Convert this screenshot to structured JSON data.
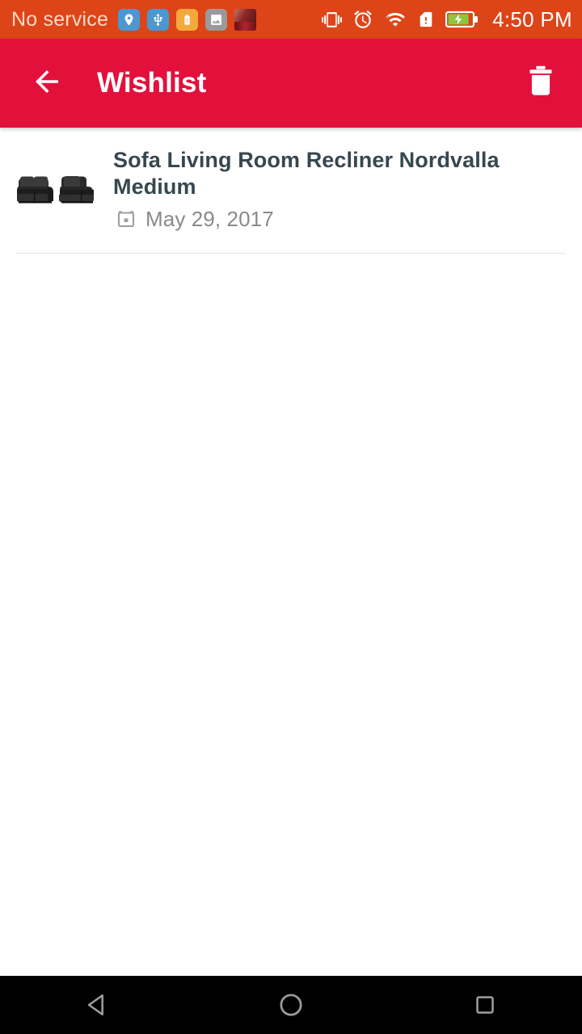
{
  "status_bar": {
    "carrier": "No service",
    "time": "4:50 PM",
    "background": "#dd4418",
    "notification_icons": [
      {
        "name": "location-pin-icon",
        "color": "#4a97d2"
      },
      {
        "name": "usb-icon",
        "color": "#4a97d2"
      },
      {
        "name": "battery-saver-icon",
        "color": "#f5a83c"
      },
      {
        "name": "image-icon",
        "color": "#9a9a9a"
      },
      {
        "name": "photo-thumbnail-icon",
        "color": "#7a1620"
      }
    ],
    "system_icons": [
      {
        "name": "vibrate-icon"
      },
      {
        "name": "alarm-clock-icon"
      },
      {
        "name": "wifi-icon"
      },
      {
        "name": "sim-card-alert-icon"
      },
      {
        "name": "battery-charging-icon",
        "fill_color": "#8dc63f"
      }
    ]
  },
  "app_bar": {
    "title": "Wishlist",
    "background": "#e3103c",
    "back_icon": "arrow-back-icon",
    "delete_icon": "delete-trash-icon"
  },
  "wishlist": {
    "items": [
      {
        "title": "Sofa Living Room Recliner Nordvalla Medium",
        "date": "May 29, 2017",
        "date_icon": "calendar-icon",
        "thumbnail": "black-leather-sofa-recliner-image"
      }
    ]
  },
  "nav_bar": {
    "background": "#000000",
    "buttons": [
      {
        "name": "nav-back-button",
        "icon": "triangle-back-icon"
      },
      {
        "name": "nav-home-button",
        "icon": "circle-home-icon"
      },
      {
        "name": "nav-recents-button",
        "icon": "square-recents-icon"
      }
    ]
  },
  "colors": {
    "app_bar_red": "#e3103c",
    "status_bar_orange": "#dd4418",
    "title_text": "#37474f",
    "meta_text": "#8a8a8a",
    "divider": "#e4e4e4"
  }
}
